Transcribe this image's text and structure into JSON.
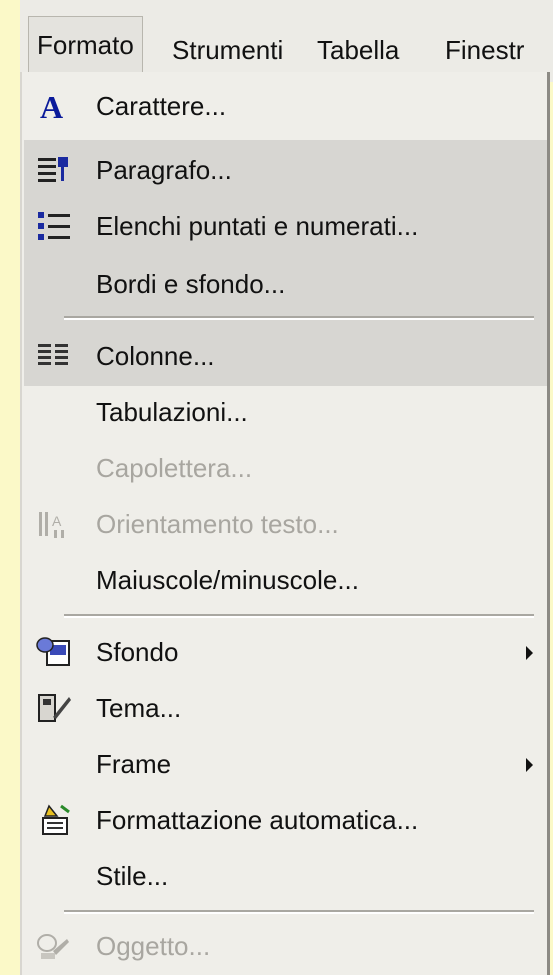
{
  "menubar": {
    "items": [
      {
        "label": "Formato"
      },
      {
        "label": "Strumenti"
      },
      {
        "label": "Tabella"
      },
      {
        "label": "Finestr"
      }
    ]
  },
  "menu": {
    "items": [
      {
        "label": "Carattere...",
        "icon": "font-a-icon",
        "enabled": true
      },
      {
        "label": "Paragrafo...",
        "icon": "paragraph-icon",
        "enabled": true
      },
      {
        "label": "Elenchi puntati e numerati...",
        "icon": "bullets-numbering-icon",
        "enabled": true
      },
      {
        "label": "Bordi e sfondo...",
        "icon": "",
        "enabled": true
      },
      {
        "label": "Colonne...",
        "icon": "columns-icon",
        "enabled": true
      },
      {
        "label": "Tabulazioni...",
        "icon": "",
        "enabled": true
      },
      {
        "label": "Capolettera...",
        "icon": "",
        "enabled": false
      },
      {
        "label": "Orientamento testo...",
        "icon": "text-direction-icon",
        "enabled": false
      },
      {
        "label": "Maiuscole/minuscole...",
        "icon": "",
        "enabled": true
      },
      {
        "label": "Sfondo",
        "icon": "background-icon",
        "enabled": true,
        "submenu": true
      },
      {
        "label": "Tema...",
        "icon": "theme-icon",
        "enabled": true
      },
      {
        "label": "Frame",
        "icon": "",
        "enabled": true,
        "submenu": true
      },
      {
        "label": "Formattazione automatica...",
        "icon": "autoformat-icon",
        "enabled": true
      },
      {
        "label": "Stile...",
        "icon": "",
        "enabled": true
      },
      {
        "label": "Oggetto...",
        "icon": "object-icon",
        "enabled": false
      }
    ]
  },
  "colors": {
    "background": "#fbf9c8",
    "menu": "#efeee9",
    "highlight": "#d7d6d2",
    "disabled_text": "#a8a6a0"
  }
}
